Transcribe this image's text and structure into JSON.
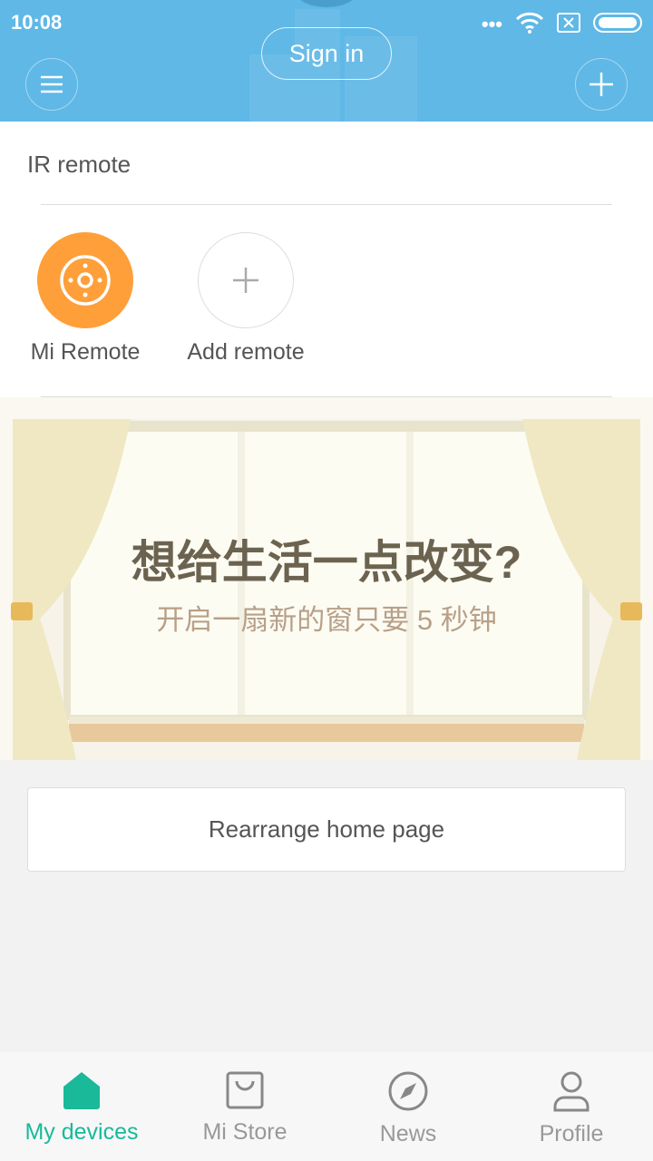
{
  "status": {
    "time": "10:08"
  },
  "header": {
    "sign_in": "Sign in"
  },
  "ir": {
    "title": "IR remote",
    "remotes": [
      {
        "label": "Mi Remote"
      },
      {
        "label": "Add remote"
      }
    ]
  },
  "banner": {
    "headline": "想给生活一点改变?",
    "subline": "开启一扇新的窗只要 5 秒钟"
  },
  "rearrange": "Rearrange home page",
  "nav": [
    {
      "label": "My devices",
      "icon": "home-icon",
      "active": true
    },
    {
      "label": "Mi Store",
      "icon": "shopping-bag-icon"
    },
    {
      "label": "News",
      "icon": "compass-icon"
    },
    {
      "label": "Profile",
      "icon": "person-icon"
    }
  ],
  "colors": {
    "header": "#5fb8e6",
    "accent": "#19b99a",
    "remote": "#ff9f3a"
  }
}
